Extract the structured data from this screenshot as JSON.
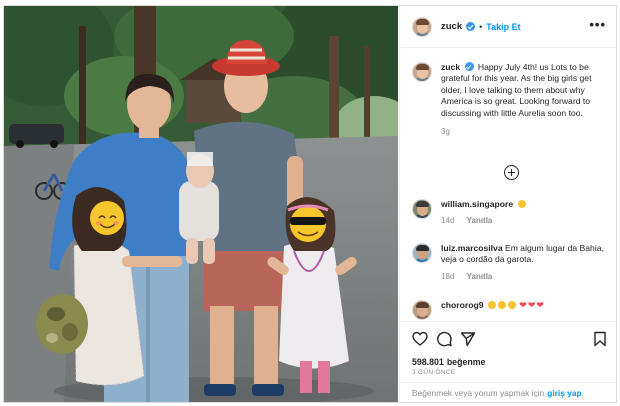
{
  "post": {
    "author": "zuck",
    "follow_label": "Takip Et",
    "separator": "•",
    "more_label": "•••",
    "caption": "Happy July 4th! us Lots to be grateful for this year. As the big girls get older, I love talking to them about why America is so great. Looking forward to discussing with little Aurelia soon too.",
    "caption_age": "3g",
    "likes_count": "598.801",
    "likes_label": "beğenme",
    "posted_ago": "3 GÜN ÖNCE"
  },
  "comments": [
    {
      "user": "william.singapore",
      "text": "",
      "age": "14d",
      "reply": "Yanıtla"
    },
    {
      "user": "luiz.marcosilva",
      "text": "Em algum lugar da Bahia, veja o cordão da garota.",
      "age": "18d",
      "reply": "Yanıtla"
    },
    {
      "user": "chororog9",
      "text": ""
    }
  ],
  "login_prompt": {
    "prefix": "Beğenmek veya yorum yapmak için",
    "link": "giriş yap",
    "suffix": "."
  },
  "icons": {
    "verified": "verified-badge-icon",
    "more": "more-options-icon",
    "load_more": "plus-circle-icon",
    "like": "heart-icon",
    "comment": "comment-bubble-icon",
    "share": "paper-plane-icon",
    "save": "bookmark-icon"
  },
  "colors": {
    "link_blue": "#0095f6",
    "verified_blue": "#3897f0",
    "text_dark": "#262626",
    "text_muted": "#8e8e8e",
    "heart_red": "#ed4956"
  }
}
